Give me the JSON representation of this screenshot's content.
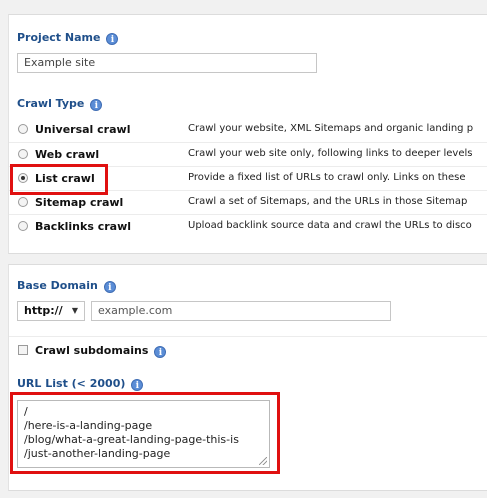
{
  "project": {
    "heading": "Project Name",
    "name_value": "Example site"
  },
  "crawl_type": {
    "heading": "Crawl Type",
    "options": [
      {
        "label": "Universal crawl",
        "desc": "Crawl your website, XML Sitemaps and organic landing p",
        "selected": false
      },
      {
        "label": "Web crawl",
        "desc": "Crawl your web site only, following links to deeper levels",
        "selected": false
      },
      {
        "label": "List crawl",
        "desc": "Provide a fixed list of URLs to crawl only. Links on these",
        "selected": true
      },
      {
        "label": "Sitemap crawl",
        "desc": "Crawl a set of Sitemaps, and the URLs in those Sitemap",
        "selected": false
      },
      {
        "label": "Backlinks crawl",
        "desc": "Upload backlink source data and crawl the URLs to disco",
        "selected": false
      }
    ]
  },
  "base_domain": {
    "heading": "Base Domain",
    "protocol": "http://",
    "domain_placeholder": "example.com"
  },
  "subdomains": {
    "label": "Crawl subdomains",
    "checked": false
  },
  "url_list": {
    "heading": "URL List (< 2000)",
    "lines": [
      "/",
      "/here-is-a-landing-page",
      "/blog/what-a-great-landing-page-this-is",
      "/just-another-landing-page"
    ]
  },
  "colors": {
    "heading": "#1f4f8a",
    "highlight": "#e01010",
    "info_icon": "#5b8dd6"
  }
}
